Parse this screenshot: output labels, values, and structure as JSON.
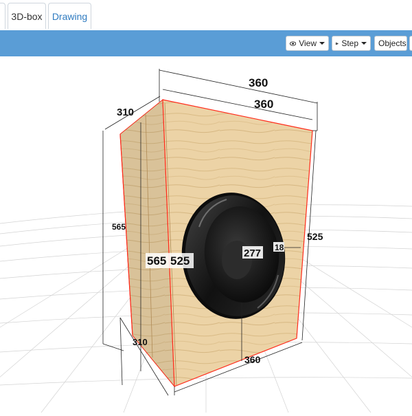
{
  "tabs": [
    {
      "label": ""
    },
    {
      "label": "3D-box"
    },
    {
      "label": "Drawing"
    }
  ],
  "toolbar": {
    "view_label": "View",
    "step_label": "Step",
    "objects_label": "Objects"
  },
  "dimensions": {
    "top_width_outer": "360",
    "top_width_inner": "360",
    "top_depth": "310",
    "left_height_outer": "565",
    "front_height_outer": "565",
    "front_height_inner": "525",
    "right_height": "525",
    "bottom_depth": "310",
    "bottom_width": "360",
    "driver_diameter": "277",
    "driver_offset": "18"
  },
  "colors": {
    "toolbar": "#5a9dd6",
    "wood": "#e8cfa2",
    "edge": "#ff2a1a"
  }
}
